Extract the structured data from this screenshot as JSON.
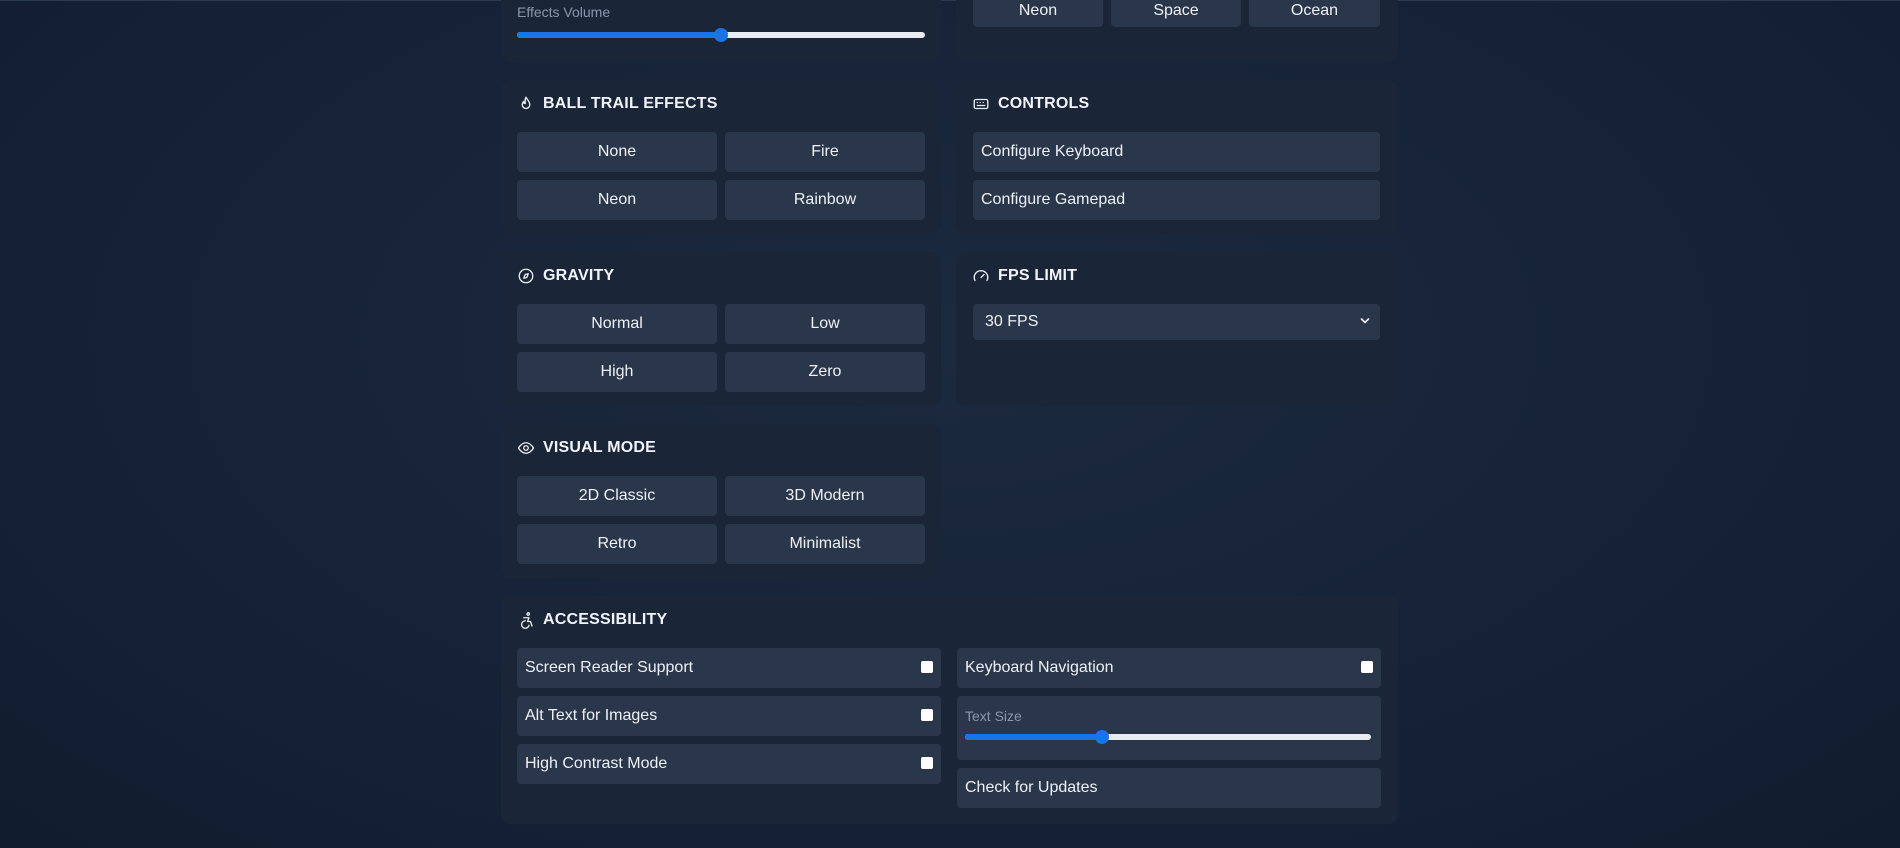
{
  "audio": {
    "effects_volume_label": "Effects Volume",
    "effects_volume_level": 0.5
  },
  "themes": {
    "buttons": [
      "Neon",
      "Space",
      "Ocean"
    ]
  },
  "ball_trail": {
    "title": "BALL TRAIL EFFECTS",
    "options": [
      "None",
      "Fire",
      "Neon",
      "Rainbow"
    ]
  },
  "controls": {
    "title": "CONTROLS",
    "options": [
      "Configure Keyboard",
      "Configure Gamepad"
    ]
  },
  "gravity": {
    "title": "GRAVITY",
    "options": [
      "Normal",
      "Low",
      "High",
      "Zero"
    ]
  },
  "fps": {
    "title": "FPS LIMIT",
    "selected": "30 FPS"
  },
  "visual_mode": {
    "title": "VISUAL MODE",
    "options": [
      "2D Classic",
      "3D Modern",
      "Retro",
      "Minimalist"
    ]
  },
  "accessibility": {
    "title": "ACCESSIBILITY",
    "left": [
      "Screen Reader Support",
      "Alt Text for Images",
      "High Contrast Mode"
    ],
    "keyboard_nav": "Keyboard Navigation",
    "text_size_label": "Text Size",
    "text_size_level": 0.33,
    "check_updates": "Check for Updates"
  }
}
